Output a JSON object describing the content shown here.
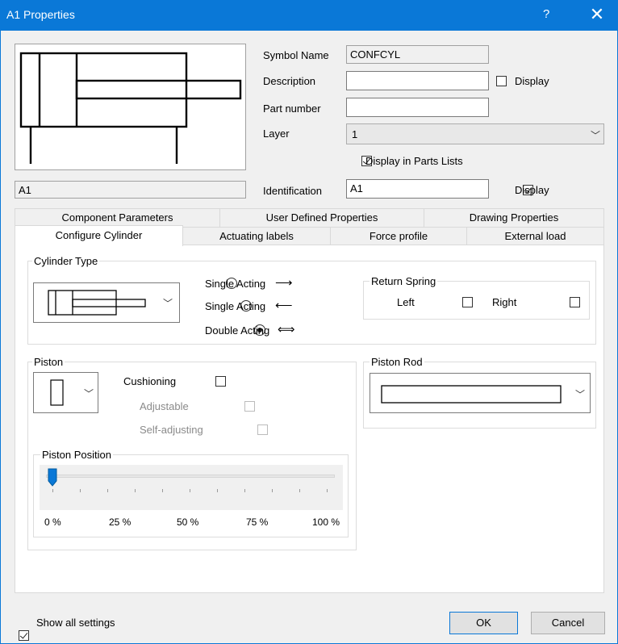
{
  "window": {
    "title": "A1 Properties",
    "help_glyph": "?",
    "close_glyph": "✕"
  },
  "header": {
    "symbol_name_label": "Symbol Name",
    "symbol_name_value": "CONFCYL",
    "description_label": "Description",
    "description_value": "",
    "description_display_label": "Display",
    "description_display_checked": false,
    "part_number_label": "Part number",
    "part_number_value": "",
    "layer_label": "Layer",
    "layer_value": "1",
    "display_parts_lists_label": "Display in Parts Lists",
    "display_parts_lists_checked": true,
    "preview_caption": "A1",
    "identification_label": "Identification",
    "identification_value": "A1",
    "identification_display_label": "Display",
    "identification_display_checked": true
  },
  "tabs": {
    "row1": [
      "Component Parameters",
      "User Defined Properties",
      "Drawing Properties"
    ],
    "row2": [
      "Configure Cylinder",
      "Actuating labels",
      "Force profile",
      "External load"
    ],
    "selected": "Configure Cylinder"
  },
  "cylinder_type": {
    "title": "Cylinder Type",
    "options": [
      {
        "label": "Single Acting",
        "arrow": "⟶",
        "selected": false
      },
      {
        "label": "Single Acting",
        "arrow": "⟵",
        "selected": false
      },
      {
        "label": "Double Acting",
        "arrow": "⟺",
        "selected": true
      }
    ]
  },
  "return_spring": {
    "title": "Return Spring",
    "left_label": "Left",
    "left_checked": false,
    "right_label": "Right",
    "right_checked": false
  },
  "piston": {
    "title": "Piston",
    "cushioning_label": "Cushioning",
    "cushioning_checked": false,
    "adjustable_label": "Adjustable",
    "adjustable_checked": false,
    "self_adjusting_label": "Self-adjusting",
    "self_adjusting_checked": false
  },
  "piston_rod": {
    "title": "Piston Rod"
  },
  "piston_position": {
    "title": "Piston Position",
    "value_percent": 0,
    "tick_labels": [
      "0 %",
      "25 %",
      "50 %",
      "75 %",
      "100 %"
    ]
  },
  "footer": {
    "show_all_settings_label": "Show all settings",
    "show_all_settings_checked": true,
    "ok_label": "OK",
    "cancel_label": "Cancel"
  }
}
